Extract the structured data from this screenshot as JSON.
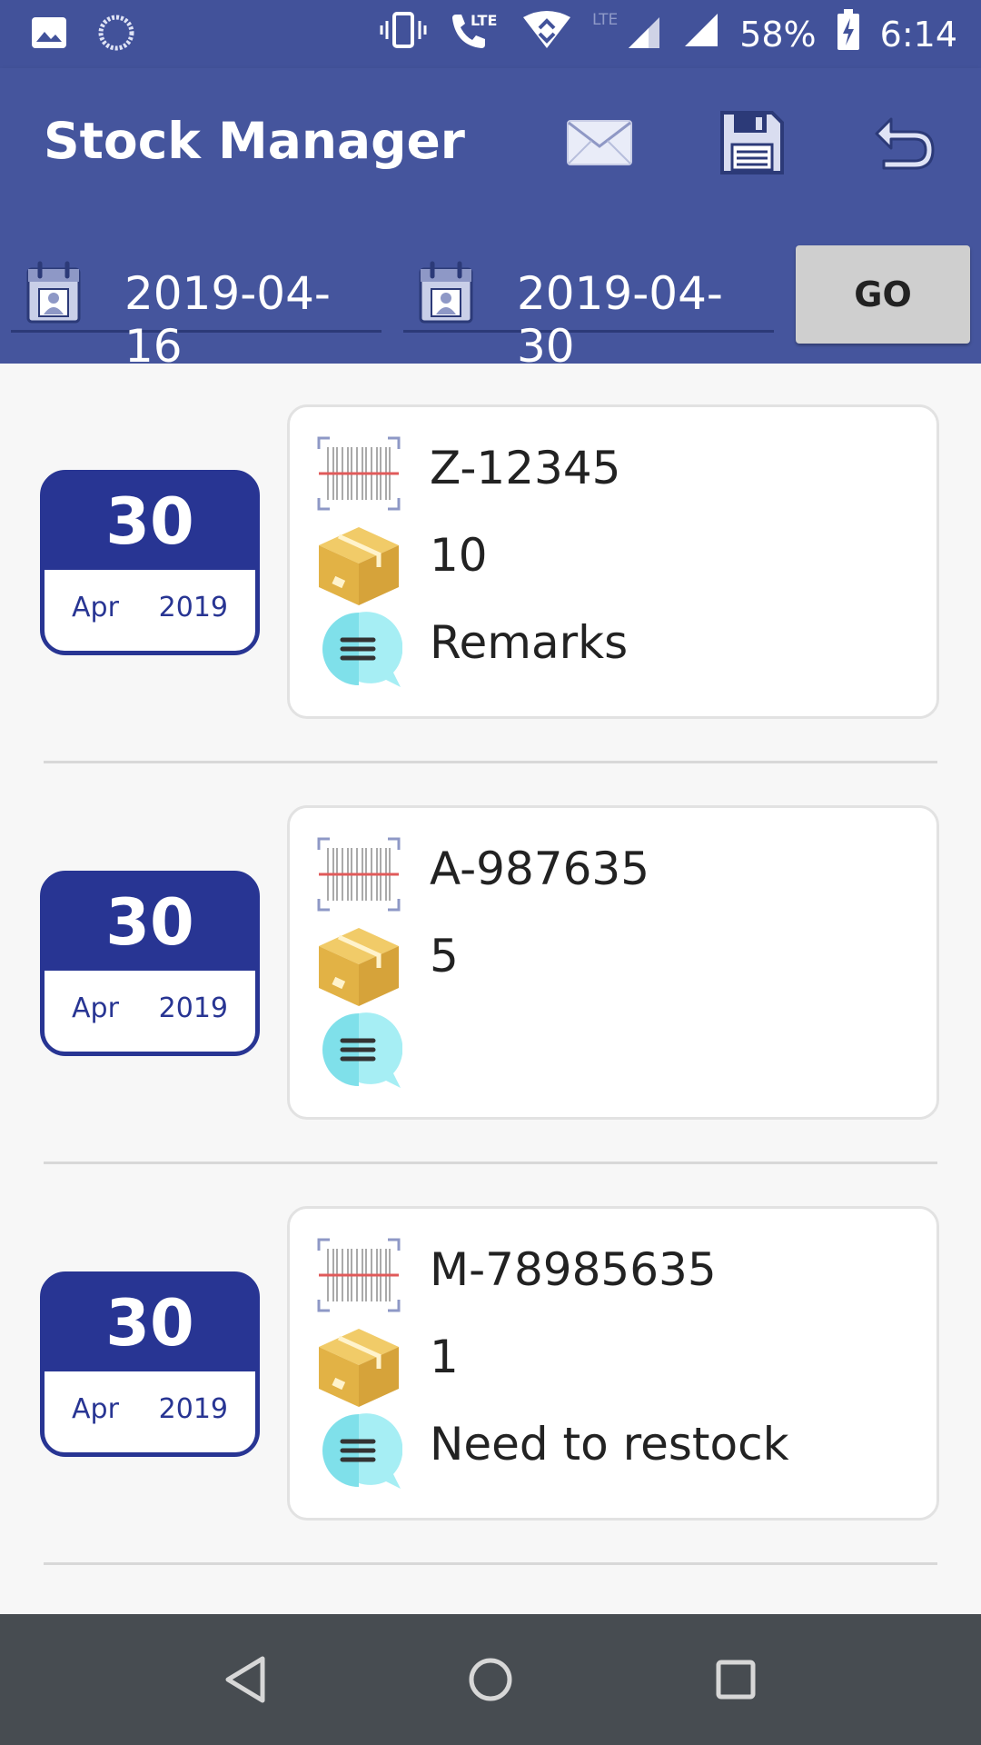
{
  "status_bar": {
    "battery": "58%",
    "time": "6:14",
    "network": "LTE"
  },
  "app_bar": {
    "title": "Stock Manager",
    "actions": [
      "mail-icon",
      "save-icon",
      "undo-icon"
    ]
  },
  "filter": {
    "from_date": "2019-04-16",
    "to_date": "2019-04-30",
    "go_label": "GO"
  },
  "entries": [
    {
      "day": "30",
      "month": "Apr",
      "year": "2019",
      "code": "Z-12345",
      "quantity": "10",
      "remark": "Remarks"
    },
    {
      "day": "30",
      "month": "Apr",
      "year": "2019",
      "code": "A-987635",
      "quantity": "5",
      "remark": ""
    },
    {
      "day": "30",
      "month": "Apr",
      "year": "2019",
      "code": "M-78985635",
      "quantity": "1",
      "remark": "Need to restock"
    }
  ],
  "colors": {
    "primary": "#45559d",
    "badge": "#283593",
    "navbar": "#474c51"
  }
}
